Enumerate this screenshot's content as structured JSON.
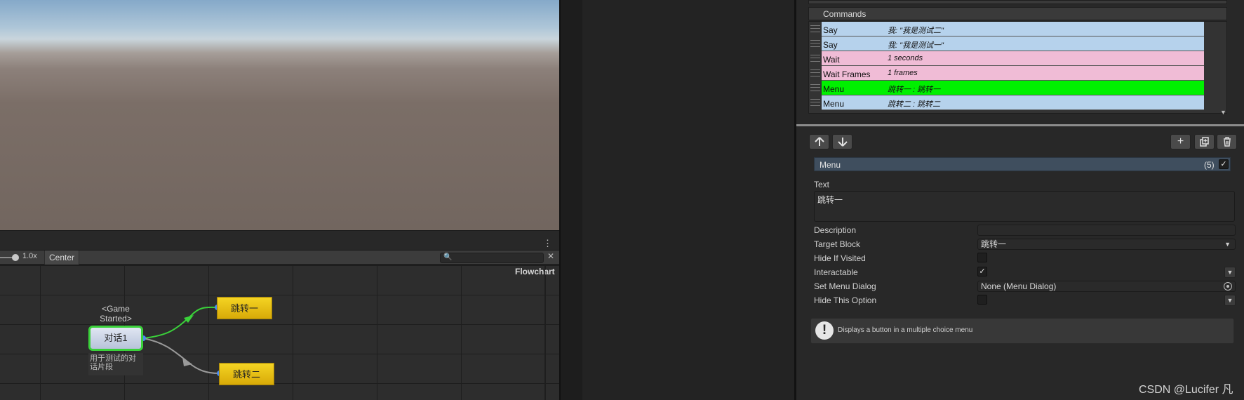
{
  "flowchart": {
    "zoom_label": "1.0x",
    "center_label": "Center",
    "search_placeholder": "",
    "title": "Flowchart",
    "event_label": "<Game Started>",
    "main_block": {
      "name": "对话1",
      "description": "用于测试的对话片段"
    },
    "blocks": [
      {
        "name": "跳转一"
      },
      {
        "name": "跳转二"
      }
    ],
    "colors": {
      "active_connection": "#3ad13a",
      "inactive_connection": "#9a9a9a",
      "block_yellow": "#f1cf1f"
    }
  },
  "inspector": {
    "commands_title": "Commands",
    "commands": [
      {
        "name": "Say",
        "summary": "我: \"我是测试二\"",
        "color": "#b6d2ec"
      },
      {
        "name": "Say",
        "summary": "我: \"我是测试一\"",
        "color": "#b6d2ec"
      },
      {
        "name": "Wait",
        "summary": "1 seconds",
        "color": "#f0bcd6"
      },
      {
        "name": "Wait Frames",
        "summary": "1 frames",
        "color": "#f0bcd6"
      },
      {
        "name": "Menu",
        "summary": "跳转一 : 跳转一",
        "color": "#00f000"
      },
      {
        "name": "Menu",
        "summary": "跳转二 : 跳转二",
        "color": "#b6d2ec"
      }
    ],
    "toolbar": {
      "up_icon": "arrow-up-icon",
      "down_icon": "arrow-down-icon",
      "add_icon": "plus-icon",
      "duplicate_icon": "duplicate-icon",
      "delete_icon": "trash-icon"
    },
    "selected": {
      "name": "Menu",
      "index": "(5)",
      "enabled": true
    },
    "properties": {
      "text_label": "Text",
      "text_value": "跳转一",
      "description_label": "Description",
      "description_value": "",
      "target_block_label": "Target Block",
      "target_block_value": "跳转一",
      "hide_if_visited_label": "Hide If Visited",
      "hide_if_visited": false,
      "interactable_label": "Interactable",
      "interactable": true,
      "set_menu_dialog_label": "Set Menu Dialog",
      "set_menu_dialog_value": "None (Menu Dialog)",
      "hide_this_option_label": "Hide This Option",
      "hide_this_option": false
    },
    "help_text": "Displays a button in a multiple choice menu"
  },
  "watermark": "CSDN @Lucifer 凡"
}
